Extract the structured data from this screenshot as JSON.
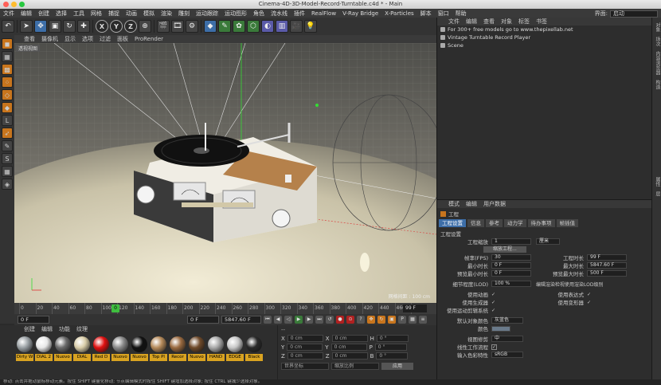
{
  "window": {
    "title": "Cinema-4D-3D-Model-Record-Turntable.c4d * - Main"
  },
  "menubar": {
    "items": [
      "文件",
      "编辑",
      "创建",
      "选择",
      "工具",
      "网格",
      "捕捉",
      "动画",
      "模拟",
      "渲染",
      "雕刻",
      "运动跟踪",
      "运动图形",
      "角色",
      "流水线",
      "插件",
      "RealFlow",
      "V-Ray Bridge",
      "X-Particles",
      "脚本",
      "窗口",
      "帮助"
    ],
    "layout_label": "界面:",
    "layout_value": "启动"
  },
  "toolbar": {
    "axes": [
      "X",
      "Y",
      "Z"
    ]
  },
  "viewport": {
    "menu": [
      "查看",
      "摄像机",
      "显示",
      "选项",
      "过滤",
      "面板",
      "ProRender"
    ],
    "label": "透视视图",
    "grid_label": "网格间距 : 100 cm"
  },
  "timeline": {
    "ticks": [
      "0",
      "20",
      "40",
      "60",
      "80",
      "100",
      "120",
      "140",
      "160",
      "180",
      "200",
      "220",
      "240",
      "260",
      "280",
      "300",
      "320",
      "340",
      "360",
      "380",
      "400",
      "420",
      "440",
      "460",
      "480"
    ],
    "current": "0",
    "end": "99 F"
  },
  "transport": {
    "start": "0 F",
    "start2": "0 F",
    "end": "5847.60 F"
  },
  "materials": {
    "menu": [
      "创建",
      "编辑",
      "功能",
      "纹理"
    ],
    "items": [
      {
        "name": "Dirty W",
        "color": "#9aa0a4"
      },
      {
        "name": "DIAL 2",
        "color": "#e8e8e8"
      },
      {
        "name": "Nuovo",
        "color": "#6a6a6a"
      },
      {
        "name": "DIAL",
        "color": "#d9cda8"
      },
      {
        "name": "Red D",
        "color": "#e01010"
      },
      {
        "name": "Nuovo",
        "color": "#8a8a8a"
      },
      {
        "name": "Nuovo",
        "color": "#111111"
      },
      {
        "name": "Top Pl",
        "color": "#b58a5a"
      },
      {
        "name": "Recor",
        "color": "#9a6a40"
      },
      {
        "name": "Nuovo",
        "color": "#6f4a2a"
      },
      {
        "name": "HAND",
        "color": "#aaaaaa"
      },
      {
        "name": "EDGE",
        "color": "#c8c8c8"
      },
      {
        "name": "Black",
        "color": "#2a2a2a"
      }
    ]
  },
  "coordinates": {
    "rows": [
      {
        "a": "X",
        "av": "0 cm",
        "b": "X",
        "bv": "0 cm",
        "c": "H",
        "cv": "0 °"
      },
      {
        "a": "Y",
        "av": "0 cm",
        "b": "Y",
        "bv": "0 cm",
        "c": "P",
        "cv": "0 °"
      },
      {
        "a": "Z",
        "av": "0 cm",
        "b": "Z",
        "bv": "0 cm",
        "c": "B",
        "cv": "0 °"
      }
    ],
    "mode1": "世界坐标",
    "mode2": "缩放比例",
    "apply": "应用"
  },
  "objects": {
    "menu": [
      "文件",
      "编辑",
      "查看",
      "对象",
      "标签",
      "书签"
    ],
    "rows": [
      "For 300+ free models go to www.thepixellab.net",
      "Vintage Turntable Record Player",
      "Scene"
    ]
  },
  "attributes": {
    "menu": [
      "模式",
      "编辑",
      "用户数据"
    ],
    "title": "工程",
    "tabs": [
      "工程设置",
      "信息",
      "参考",
      "动力学",
      "待办事项",
      "帧插值"
    ],
    "section": "工程设置",
    "scale_label": "工程缩放",
    "scale_value": "1",
    "scale_unit": "厘米",
    "scale_button": "缩放工程...",
    "left": [
      {
        "label": "帧率(FPS)",
        "value": "30"
      },
      {
        "label": "最小时长",
        "value": "0 F"
      },
      {
        "label": "预览最小时长",
        "value": "0 F"
      }
    ],
    "right": [
      {
        "label": "工程时长",
        "value": "99 F"
      },
      {
        "label": "最大时长",
        "value": "5847.60 F"
      },
      {
        "label": "预览最大时长",
        "value": "500 F"
      }
    ],
    "lod_label": "细节程度(LOD)",
    "lod_value": "100 %",
    "lod_note": "编辑渲染检视使用渲染LOD级别",
    "checks_left": [
      "使用动画",
      "使用生成器",
      "使用运动剪辑系统"
    ],
    "checks_right": [
      "使用表达式",
      "使用变形器"
    ],
    "color_label": "默认对象颜色",
    "color_value": "灰蓝色",
    "color2": "颜色",
    "linear_label": "视图修剪",
    "linear_value": "中",
    "workflow_label": "线性工作流程",
    "input_label": "输入色彩特性",
    "input_value": "sRGB"
  },
  "status": {
    "text": "移动: 点击并拖动鼠标移动元素。按住 SHIFT 键量化移动; 节点编辑模式时按住 SHIFT 键增加选择对象; 按住 CTRL 键减少选择对象。"
  }
}
